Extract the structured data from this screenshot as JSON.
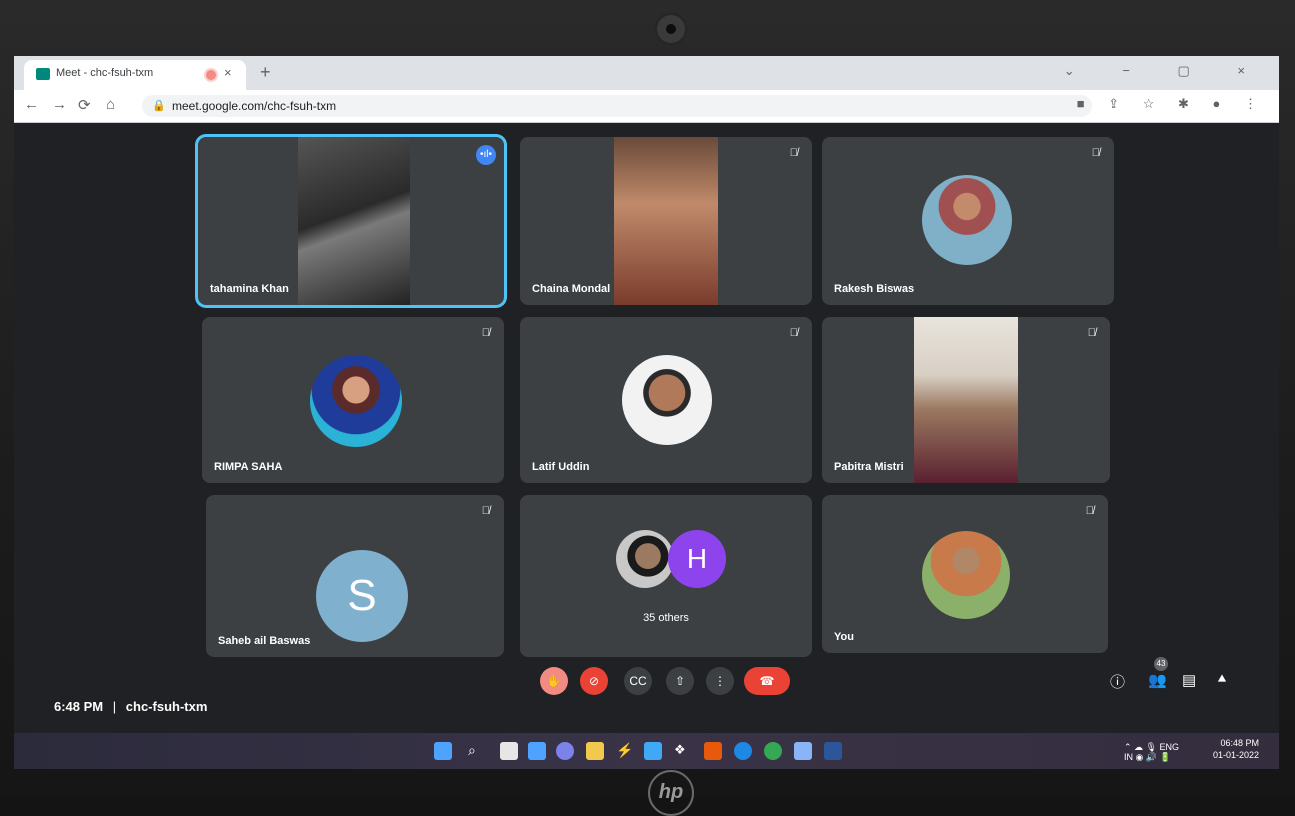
{
  "browser": {
    "tab_title": "Meet - chc-fsuh-txm",
    "tab_close": "×",
    "new_tab": "+",
    "url": "meet.google.com/chc-fsuh-txm",
    "window_controls": "⌄ − ▢ ×"
  },
  "participants": [
    {
      "name": "tahamina Khan",
      "state": "speaking"
    },
    {
      "name": "Chaina Mondal",
      "state": "muted"
    },
    {
      "name": "Rakesh Biswas",
      "state": "muted"
    },
    {
      "name": "RIMPA SAHA",
      "state": "muted"
    },
    {
      "name": "Latif Uddin",
      "state": "muted"
    },
    {
      "name": "Pabitra Mistri",
      "state": "muted"
    },
    {
      "name": "Saheb ail Baswas",
      "state": "muted",
      "avatar_letter": "S"
    },
    {
      "name": "35 others",
      "avatar_letter": "H"
    },
    {
      "name": "You",
      "state": "muted"
    }
  ],
  "meeting": {
    "time": "6:48 PM",
    "separator": "|",
    "code": "chc-fsuh-txm",
    "participant_count": "43"
  },
  "controls": [
    "hand-raise",
    "camera-off",
    "captions",
    "present",
    "more-options",
    "leave-call"
  ],
  "right_controls": [
    "info",
    "people",
    "chat",
    "activities"
  ],
  "taskbar": {
    "lang_line1": "ENG",
    "lang_line2": "IN",
    "clock_time": "06:48 PM",
    "clock_date": "01-01-2022"
  },
  "colors": {
    "meet_bg": "#202124",
    "tile_bg": "#3c4043",
    "active_border": "#4fc3f7",
    "leave_red": "#ea4335",
    "mute_btn": "#f28b82",
    "speak_blue": "#4285f4"
  }
}
